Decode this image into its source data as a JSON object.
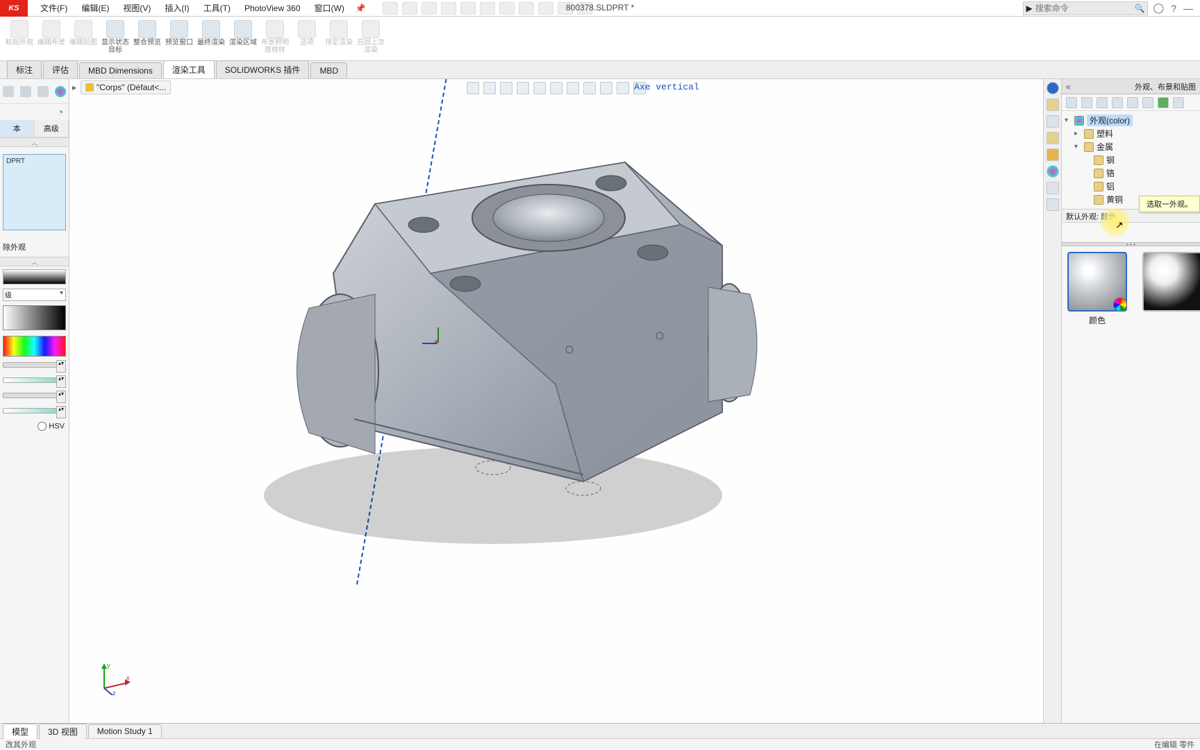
{
  "app": {
    "brand": "KS",
    "doc_title": "800378.SLDPRT *",
    "search_placeholder": "搜索命令"
  },
  "menu": [
    "文件(F)",
    "编辑(E)",
    "视图(V)",
    "插入(I)",
    "工具(T)",
    "PhotoView 360",
    "窗口(W)"
  ],
  "ribbon": [
    {
      "label": "粘贴外观",
      "dis": true
    },
    {
      "label": "编辑布景",
      "dis": true
    },
    {
      "label": "编辑贴图",
      "dis": true
    },
    {
      "label": "显示状态目标",
      "dis": false
    },
    {
      "label": "整合预览",
      "dis": false
    },
    {
      "label": "预览窗口",
      "dis": false
    },
    {
      "label": "最终渲染",
      "dis": false
    },
    {
      "label": "渲染区域",
      "dis": false
    },
    {
      "label": "布景照明度校样",
      "dis": true
    },
    {
      "label": "选项",
      "dis": true
    },
    {
      "label": "排定渲染",
      "dis": true
    },
    {
      "label": "召回上次渲染",
      "dis": true
    }
  ],
  "tabs": [
    "标注",
    "评估",
    "MBD Dimensions",
    "渲染工具",
    "SOLIDWORKS 插件",
    "MBD"
  ],
  "tabs_active": 3,
  "breadcrumb": {
    "node": "\"Corps\"  (Défaut<..."
  },
  "viewport": {
    "axis_label": "Axe vertical",
    "triad": {
      "x": "x",
      "y": "y",
      "z": "z"
    }
  },
  "left_panel": {
    "filter_basic": "本",
    "filter_adv": "高级",
    "thumb_label": "DPRT",
    "remove_app": "除外观",
    "hsv": "HSV",
    "level": "级"
  },
  "right_panel": {
    "title": "外观、布景和贴图",
    "tree": [
      {
        "depth": 0,
        "toggle": "▾",
        "icon": "color",
        "label": "外观(color)",
        "sel": true
      },
      {
        "depth": 1,
        "toggle": "▸",
        "icon": "folder",
        "label": "塑料"
      },
      {
        "depth": 1,
        "toggle": "▾",
        "icon": "folder",
        "label": "金属"
      },
      {
        "depth": 2,
        "toggle": "",
        "icon": "folder",
        "label": "钢"
      },
      {
        "depth": 2,
        "toggle": "",
        "icon": "folder",
        "label": "铬"
      },
      {
        "depth": 2,
        "toggle": "",
        "icon": "folder",
        "label": "铝"
      },
      {
        "depth": 2,
        "toggle": "",
        "icon": "folder",
        "label": "黄铜"
      }
    ],
    "default_app": "默认外观: 颜色",
    "tooltip": "选取一外观。",
    "swatch_label": "颜色"
  },
  "bottom_tabs": [
    "模型",
    "3D 视图",
    "Motion Study 1"
  ],
  "bottom_active": 0,
  "status": {
    "left": "改其外观",
    "right": "在编辑 零件"
  }
}
